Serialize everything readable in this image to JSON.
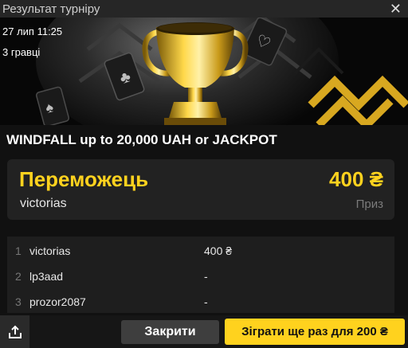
{
  "window": {
    "title": "Результат турніру",
    "close_icon": "close-icon"
  },
  "banner": {
    "date": "27 лип 11:25",
    "players": "3 гравці"
  },
  "tournament": {
    "name": "WINDFALL up to 20,000 UAH or JACKPOT"
  },
  "winner": {
    "label": "Переможець",
    "name": "victorias",
    "amount": "400 ₴",
    "prize_label": "Приз"
  },
  "results": [
    {
      "rank": "1",
      "name": "victorias",
      "prize": "400 ₴"
    },
    {
      "rank": "2",
      "name": "lp3aad",
      "prize": "-"
    },
    {
      "rank": "3",
      "name": "prozor2087",
      "prize": "-"
    }
  ],
  "footer": {
    "share_icon": "share-icon",
    "close_label": "Закрити",
    "play_again_label": "Зіграти ще раз для 200 ₴"
  },
  "colors": {
    "accent": "#ffd21e",
    "panel": "#222222",
    "background": "#111111"
  }
}
